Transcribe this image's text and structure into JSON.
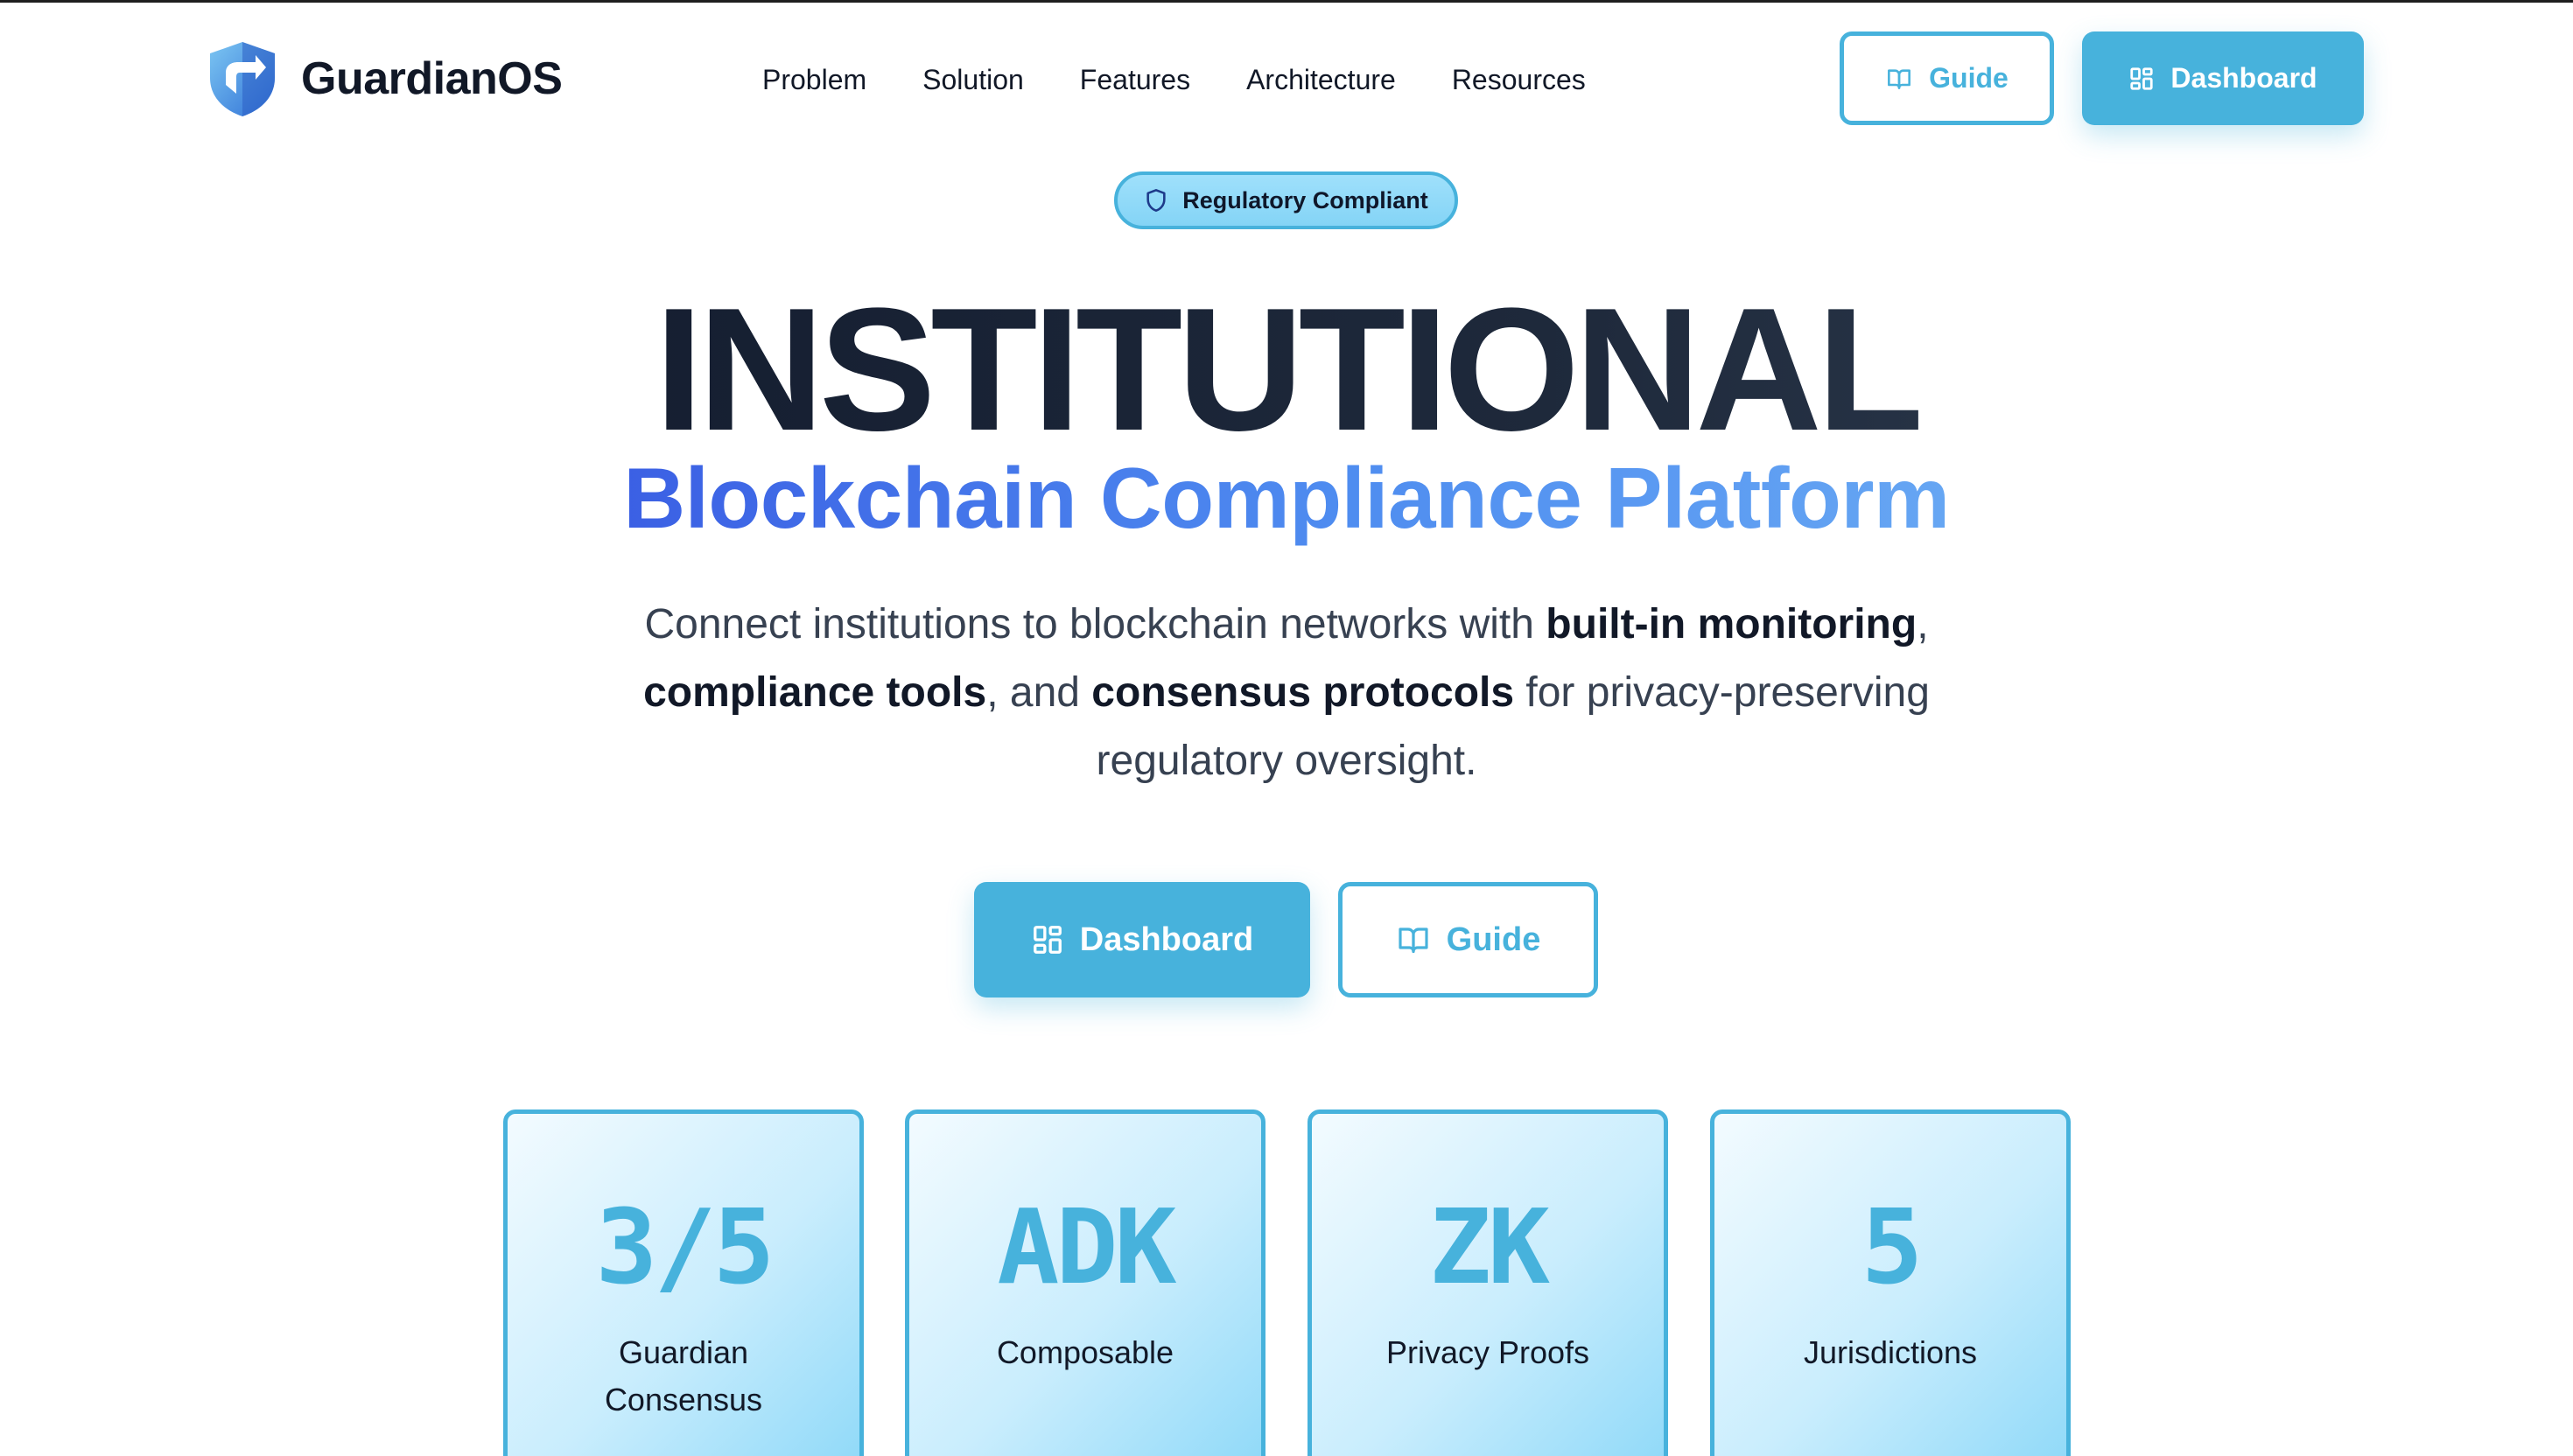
{
  "brand": {
    "name": "GuardianOS"
  },
  "nav": {
    "links": [
      "Problem",
      "Solution",
      "Features",
      "Architecture",
      "Resources"
    ],
    "guide_label": "Guide",
    "dashboard_label": "Dashboard"
  },
  "hero": {
    "badge": "Regulatory Compliant",
    "headline": "INSTITUTIONAL",
    "subheadline": "Blockchain Compliance Platform",
    "description": {
      "p1": "Connect institutions to blockchain networks with ",
      "b1": "built-in monitoring",
      "p2": ", ",
      "b2": "compliance tools",
      "p3": ", and ",
      "b3": "consensus protocols",
      "p4": " for privacy-preserving regulatory oversight."
    },
    "cta_dashboard": "Dashboard",
    "cta_guide": "Guide"
  },
  "stats": [
    {
      "value": "3/5",
      "label": "Guardian Consensus"
    },
    {
      "value": "ADK",
      "label": "Composable"
    },
    {
      "value": "ZK",
      "label": "Privacy Proofs"
    },
    {
      "value": "5",
      "label": "Jurisdictions"
    }
  ],
  "colors": {
    "accent": "#47b2dc",
    "headline": "#0f172a",
    "subheadline_start": "#3b60e4",
    "subheadline_end": "#66a6f3"
  },
  "icons": {
    "logo": "shield-logo-icon",
    "guide": "book-open-icon",
    "dashboard": "layout-grid-icon",
    "badge": "shield-icon"
  }
}
